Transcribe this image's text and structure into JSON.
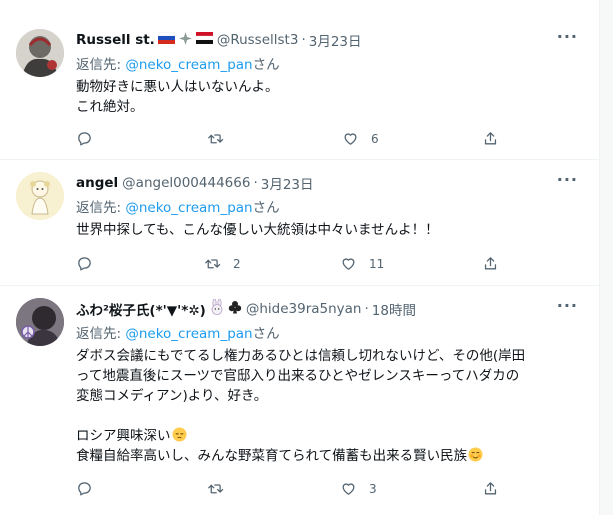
{
  "colors": {
    "accent": "#1d9bf0",
    "muted": "#536471",
    "text": "#0f1419",
    "divider": "#eff3f4"
  },
  "tweets": [
    {
      "name": "Russell st.",
      "handle": "@Russellst3",
      "dot": "·",
      "time": "3月23日",
      "name_emojis": [
        "russia-flag",
        "sparkle-leaf",
        "yemen-flag"
      ],
      "reply_prefix": "返信先: ",
      "reply_mention": "@neko_cream_pan",
      "reply_suffix": "さん",
      "lines": [
        "動物好きに悪い人はいないんよ。",
        "これ絶対。"
      ],
      "reply_count": "",
      "retweet_count": "",
      "like_count": "6"
    },
    {
      "name": "angel",
      "handle": "@angel000444666",
      "dot": "·",
      "time": "3月23日",
      "name_emojis": [],
      "reply_prefix": "返信先: ",
      "reply_mention": "@neko_cream_pan",
      "reply_suffix": "さん",
      "lines": [
        "世界中探しても、こんな優しい大統領は中々いませんよ！！"
      ],
      "reply_count": "",
      "retweet_count": "2",
      "like_count": "11"
    },
    {
      "name": "ふわ²桜子氏(*'▼'*✲)",
      "handle": "@hide39ra5nyan",
      "dot": "·",
      "time": "18時間",
      "name_emojis": [
        "rabbit-face",
        "club-suit"
      ],
      "reply_prefix": "返信先: ",
      "reply_mention": "@neko_cream_pan",
      "reply_suffix": "さん",
      "lines": [
        "ダボス会議にもでてるし権力あるひとは信頼し切れないけど、その他(岸田",
        "って地震直後にスーツで官邸入り出来るひとやゼレンスキーってハダカの",
        "変態コメディアン)より、好き。",
        "",
        "ロシア興味深い",
        "食糧自給率高いし、みんな野菜育てられて備蓄も出来る賢い民族"
      ],
      "reply_count": "",
      "retweet_count": "",
      "like_count": "3"
    }
  ],
  "more_label": "···"
}
